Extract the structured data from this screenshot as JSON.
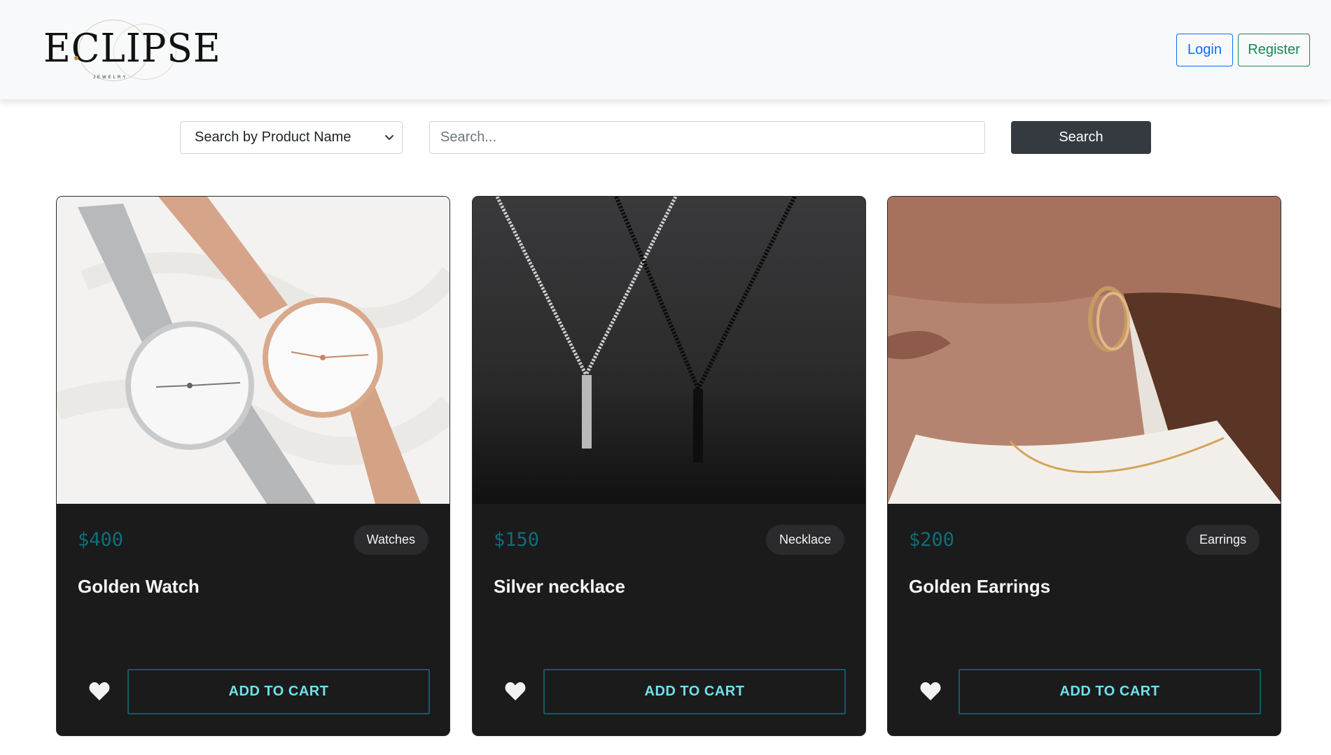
{
  "brand": {
    "name": "ECLIPSE",
    "tagline": "JEWELRY"
  },
  "nav": {
    "login_label": "Login",
    "register_label": "Register"
  },
  "search": {
    "mode_selected": "Search by Product Name",
    "placeholder": "Search...",
    "button_label": "Search"
  },
  "products": [
    {
      "price": "$400",
      "category": "Watches",
      "name": "Golden Watch",
      "cart_label": "ADD TO CART"
    },
    {
      "price": "$150",
      "category": "Necklace",
      "name": "Silver necklace",
      "cart_label": "ADD TO CART"
    },
    {
      "price": "$200",
      "category": "Earrings",
      "name": "Golden Earrings",
      "cart_label": "ADD TO CART"
    }
  ],
  "colors": {
    "navbar_bg": "#f8f9fa",
    "login": "#0d6efd",
    "register": "#198754",
    "search_button": "#343a40",
    "card_bg": "#1b1b1c",
    "price": "#0f6e78",
    "cart_border": "#0d5e66",
    "cart_text": "#6ee0ea"
  },
  "icons": {
    "heart": "heart-icon",
    "select_chevron": "chevron-down-icon"
  }
}
